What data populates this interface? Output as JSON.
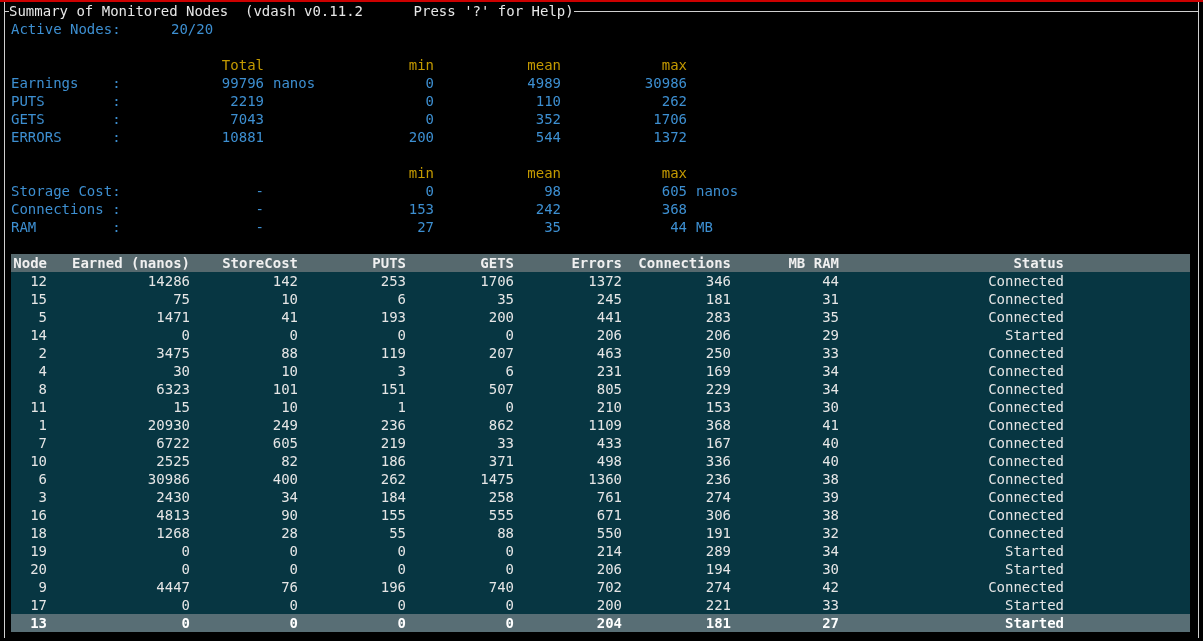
{
  "title": "Summary of Monitored Nodes  (vdash v0.11.2      Press '?' for Help)",
  "active_nodes": {
    "label": "Active Nodes:",
    "value": "20/20"
  },
  "stats_header": {
    "total": "Total",
    "min": "min",
    "mean": "mean",
    "max": "max"
  },
  "stats": [
    {
      "label": "Earnings    :",
      "total": "99796",
      "total_unit": "nanos",
      "min": "0",
      "mean": "4989",
      "max": "30986"
    },
    {
      "label": "PUTS        :",
      "total": "2219",
      "min": "0",
      "mean": "110",
      "max": "262"
    },
    {
      "label": "GETS        :",
      "total": "7043",
      "min": "0",
      "mean": "352",
      "max": "1706"
    },
    {
      "label": "ERRORS      :",
      "total": "10881",
      "min": "200",
      "mean": "544",
      "max": "1372"
    }
  ],
  "resource_header": {
    "min": "min",
    "mean": "mean",
    "max": "max"
  },
  "resources": [
    {
      "label": "Storage Cost:",
      "total": "-",
      "min": "0",
      "mean": "98",
      "max": "605",
      "max_unit": "nanos"
    },
    {
      "label": "Connections :",
      "total": "-",
      "min": "153",
      "mean": "242",
      "max": "368"
    },
    {
      "label": "RAM         :",
      "total": "-",
      "min": "27",
      "mean": "35",
      "max": "44",
      "max_unit": "MB"
    }
  ],
  "table": {
    "columns": [
      "Node",
      "Earned (nanos)",
      "StoreCost",
      "PUTS",
      "GETS",
      "Errors",
      "Connections",
      "MB RAM",
      "Status"
    ],
    "rows": [
      {
        "cells": [
          "12",
          "14286",
          "142",
          "253",
          "1706",
          "1372",
          "346",
          "44",
          "Connected"
        ],
        "selected": false
      },
      {
        "cells": [
          "15",
          "75",
          "10",
          "6",
          "35",
          "245",
          "181",
          "31",
          "Connected"
        ],
        "selected": false
      },
      {
        "cells": [
          "5",
          "1471",
          "41",
          "193",
          "200",
          "441",
          "283",
          "35",
          "Connected"
        ],
        "selected": false
      },
      {
        "cells": [
          "14",
          "0",
          "0",
          "0",
          "0",
          "206",
          "206",
          "29",
          "Started"
        ],
        "selected": false
      },
      {
        "cells": [
          "2",
          "3475",
          "88",
          "119",
          "207",
          "463",
          "250",
          "33",
          "Connected"
        ],
        "selected": false
      },
      {
        "cells": [
          "4",
          "30",
          "10",
          "3",
          "6",
          "231",
          "169",
          "34",
          "Connected"
        ],
        "selected": false
      },
      {
        "cells": [
          "8",
          "6323",
          "101",
          "151",
          "507",
          "805",
          "229",
          "34",
          "Connected"
        ],
        "selected": false
      },
      {
        "cells": [
          "11",
          "15",
          "10",
          "1",
          "0",
          "210",
          "153",
          "30",
          "Connected"
        ],
        "selected": false
      },
      {
        "cells": [
          "1",
          "20930",
          "249",
          "236",
          "862",
          "1109",
          "368",
          "41",
          "Connected"
        ],
        "selected": false
      },
      {
        "cells": [
          "7",
          "6722",
          "605",
          "219",
          "33",
          "433",
          "167",
          "40",
          "Connected"
        ],
        "selected": false
      },
      {
        "cells": [
          "10",
          "2525",
          "82",
          "186",
          "371",
          "498",
          "336",
          "40",
          "Connected"
        ],
        "selected": false
      },
      {
        "cells": [
          "6",
          "30986",
          "400",
          "262",
          "1475",
          "1360",
          "236",
          "38",
          "Connected"
        ],
        "selected": false
      },
      {
        "cells": [
          "3",
          "2430",
          "34",
          "184",
          "258",
          "761",
          "274",
          "39",
          "Connected"
        ],
        "selected": false
      },
      {
        "cells": [
          "16",
          "4813",
          "90",
          "155",
          "555",
          "671",
          "306",
          "38",
          "Connected"
        ],
        "selected": false
      },
      {
        "cells": [
          "18",
          "1268",
          "28",
          "55",
          "88",
          "550",
          "191",
          "32",
          "Connected"
        ],
        "selected": false
      },
      {
        "cells": [
          "19",
          "0",
          "0",
          "0",
          "0",
          "214",
          "289",
          "34",
          "Started"
        ],
        "selected": false
      },
      {
        "cells": [
          "20",
          "0",
          "0",
          "0",
          "0",
          "206",
          "194",
          "30",
          "Started"
        ],
        "selected": false
      },
      {
        "cells": [
          "9",
          "4447",
          "76",
          "196",
          "740",
          "702",
          "274",
          "42",
          "Connected"
        ],
        "selected": false
      },
      {
        "cells": [
          "17",
          "0",
          "0",
          "0",
          "0",
          "200",
          "221",
          "33",
          "Started"
        ],
        "selected": false
      },
      {
        "cells": [
          "13",
          "0",
          "0",
          "0",
          "0",
          "204",
          "181",
          "27",
          "Started"
        ],
        "selected": true
      }
    ]
  }
}
